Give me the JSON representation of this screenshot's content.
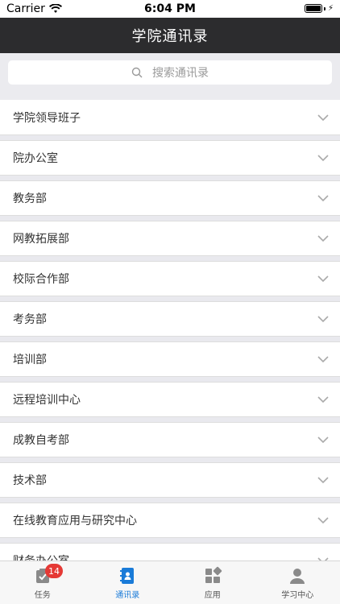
{
  "status_bar": {
    "carrier": "Carrier",
    "time": "6:04 PM"
  },
  "nav": {
    "title": "学院通讯录"
  },
  "search": {
    "placeholder": "搜索通讯录"
  },
  "list": {
    "items": [
      {
        "label": "学院领导班子"
      },
      {
        "label": "院办公室"
      },
      {
        "label": "教务部"
      },
      {
        "label": "网教拓展部"
      },
      {
        "label": "校际合作部"
      },
      {
        "label": "考务部"
      },
      {
        "label": "培训部"
      },
      {
        "label": "远程培训中心"
      },
      {
        "label": "成教自考部"
      },
      {
        "label": "技术部"
      },
      {
        "label": "在线教育应用与研究中心"
      },
      {
        "label": "财务办公室"
      }
    ]
  },
  "tabs": [
    {
      "label": "任务",
      "icon": "task-icon",
      "badge": "14"
    },
    {
      "label": "通讯录",
      "icon": "contacts-icon",
      "active": true
    },
    {
      "label": "应用",
      "icon": "apps-icon"
    },
    {
      "label": "学习中心",
      "icon": "person-icon"
    }
  ],
  "colors": {
    "nav_bg": "#2c2c2e",
    "active_tab": "#1a7bd8",
    "badge": "#e53935"
  }
}
